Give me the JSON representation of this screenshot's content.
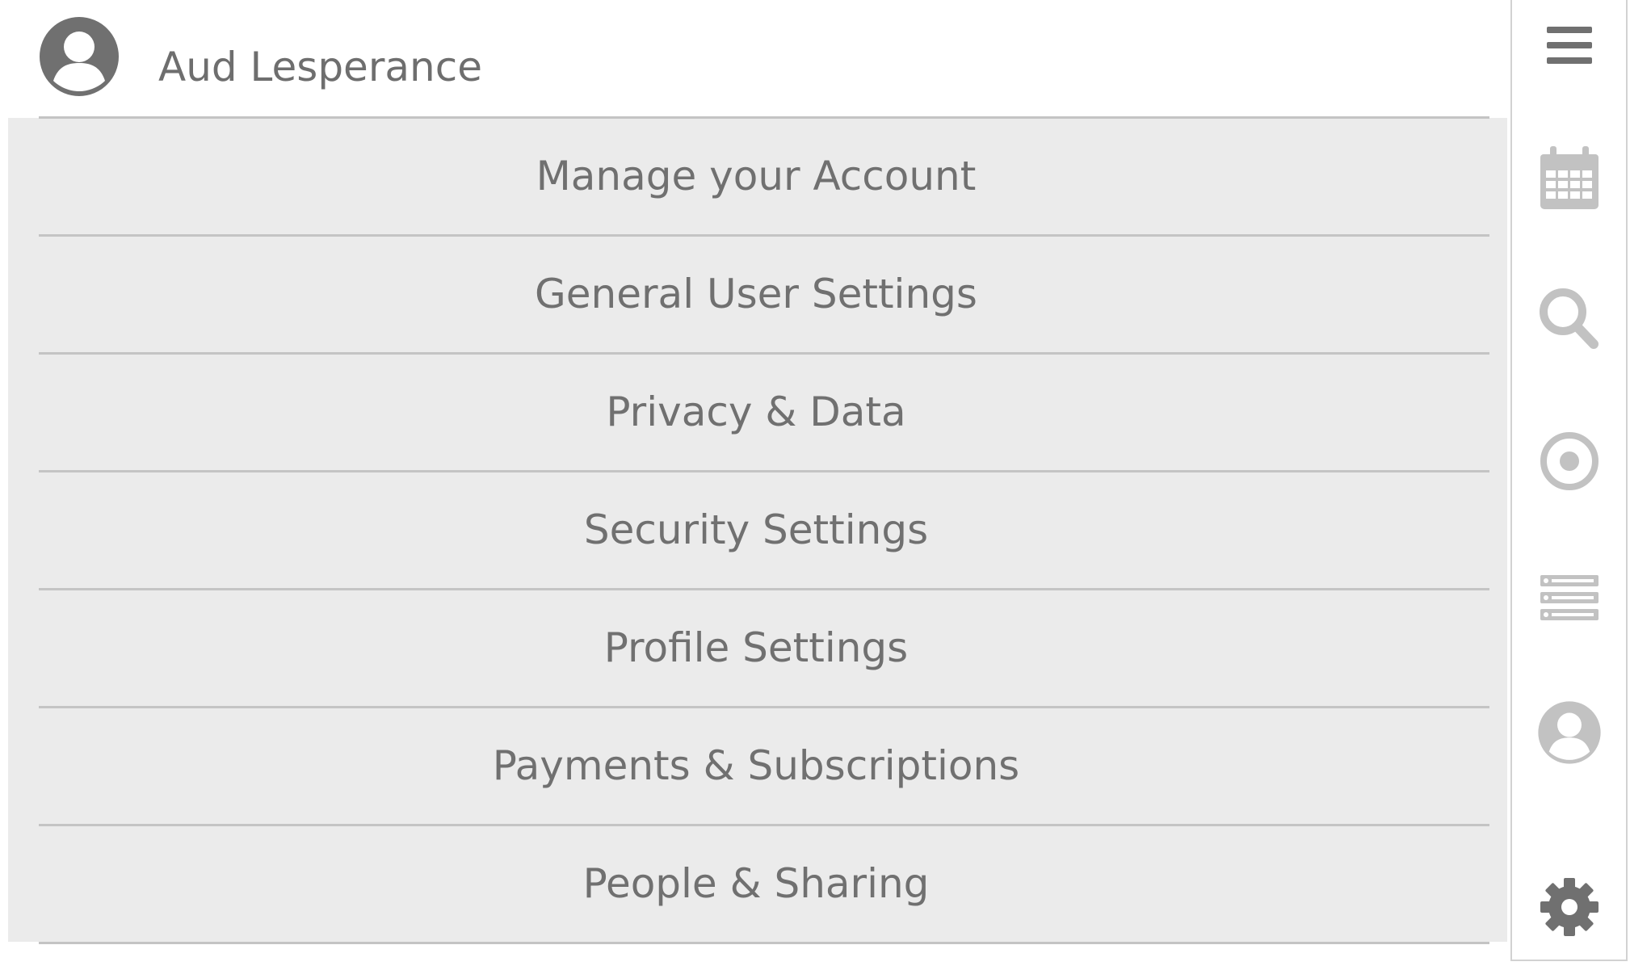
{
  "header": {
    "user_name": "Aud Lesperance",
    "avatar_icon": "user-circle-icon"
  },
  "menu": {
    "items": [
      {
        "label": "Manage your Account"
      },
      {
        "label": "General User Settings"
      },
      {
        "label": "Privacy & Data"
      },
      {
        "label": "Security Settings"
      },
      {
        "label": "Profile Settings"
      },
      {
        "label": "Payments & Subscriptions"
      },
      {
        "label": "People & Sharing"
      }
    ]
  },
  "rail": {
    "icons": [
      "hamburger-menu-icon",
      "calendar-icon",
      "search-icon",
      "target-icon",
      "list-icon",
      "user-circle-icon",
      "gear-icon"
    ]
  },
  "colors": {
    "menu_background": "#ebebeb",
    "divider": "#c4c4c4",
    "text": "#707070",
    "icon_dark": "#707070",
    "icon_light": "#c2c2c2"
  }
}
